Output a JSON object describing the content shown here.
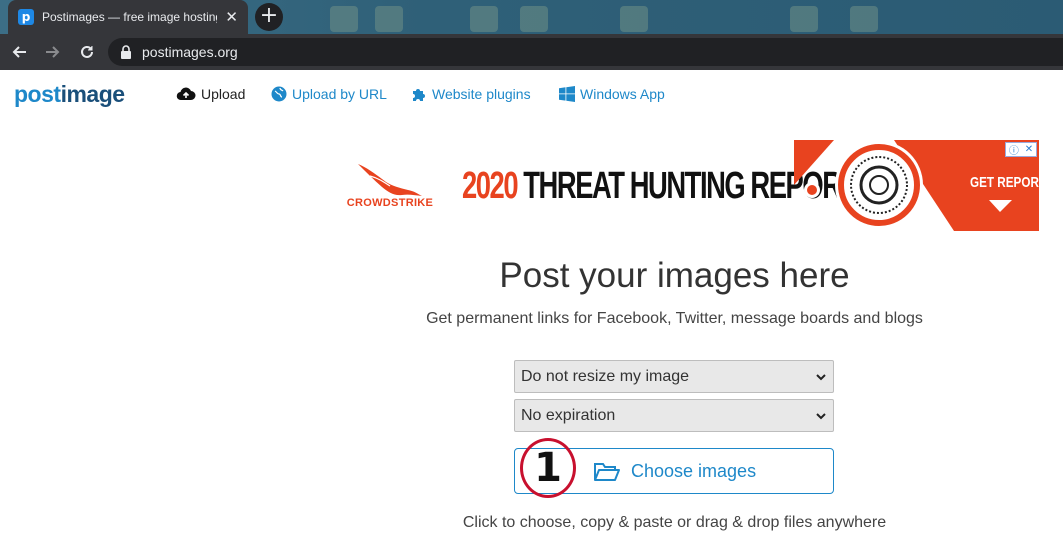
{
  "browser": {
    "tab_title": "Postimages — free image hosting",
    "tab_close": "✕",
    "new_tab": "+",
    "url": "postimages.org",
    "favicon_letter": "p"
  },
  "header": {
    "logo_part1": "post",
    "logo_part2": "image",
    "nav": [
      {
        "label": "Upload",
        "icon": "cloud-upload-icon"
      },
      {
        "label": "Upload by URL",
        "icon": "globe-icon"
      },
      {
        "label": "Website plugins",
        "icon": "puzzle-icon"
      },
      {
        "label": "Windows App",
        "icon": "windows-icon"
      }
    ],
    "colors": {
      "brand": "#1e88c9",
      "brand_dark": "#1a4f7a"
    }
  },
  "ad": {
    "brand": "CROWDSTRIKE",
    "year": "2020",
    "headline": "THREAT HUNTING REPORT",
    "cta": "GET REPORT",
    "choices": [
      "ⓘ",
      "✕"
    ],
    "accent": "#e8431f"
  },
  "main": {
    "title": "Post your images here",
    "subtitle": "Get permanent links for Facebook, Twitter, message boards and blogs",
    "resize_select": {
      "value": "Do not resize my image"
    },
    "expiration_select": {
      "value": "No expiration"
    },
    "choose_button": "Choose images",
    "step_marker": "1",
    "hint": "Click to choose, copy & paste or drag & drop files anywhere"
  }
}
